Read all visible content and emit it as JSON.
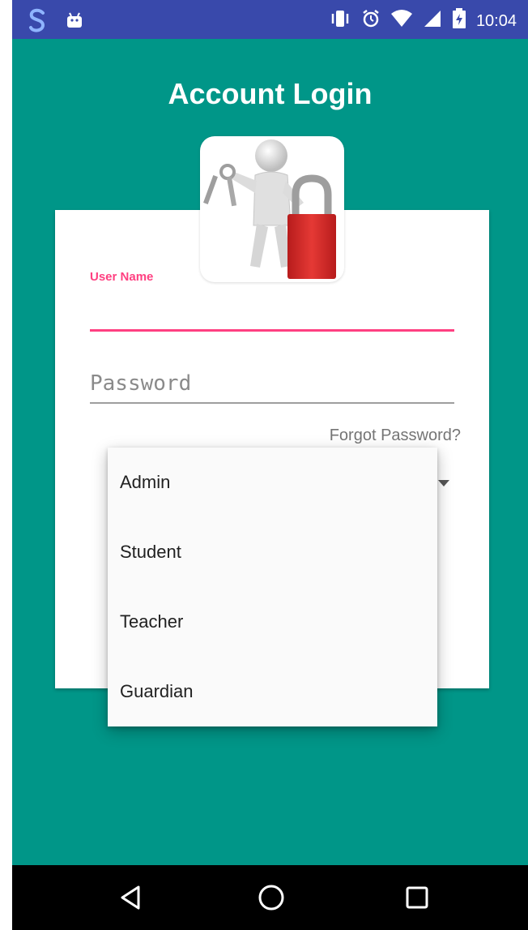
{
  "status_bar": {
    "time": "10:04",
    "icons": [
      "sync-icon",
      "android-icon",
      "vibrate-icon",
      "alarm-icon",
      "wifi-icon",
      "signal-icon",
      "battery-icon"
    ]
  },
  "page": {
    "title": "Account Login"
  },
  "form": {
    "username_label": "User Name",
    "username_value": "",
    "password_placeholder": "Password",
    "forgot_password": "Forgot Password?"
  },
  "role_dropdown": {
    "options": [
      "Admin",
      "Student",
      "Teacher",
      "Guardian"
    ]
  },
  "navigation": {
    "icons": [
      "back-icon",
      "home-icon",
      "recents-icon"
    ]
  },
  "colors": {
    "background": "#009688",
    "status_bar": "#3949ab",
    "accent": "#ff4081"
  }
}
